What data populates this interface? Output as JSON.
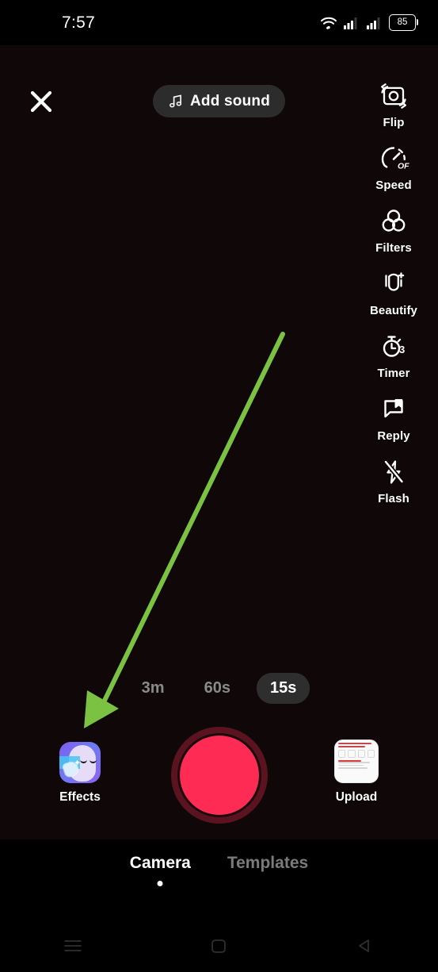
{
  "status_bar": {
    "time": "7:57",
    "battery_level": "85",
    "icons": [
      "wifi-icon",
      "signal-sim1-icon",
      "signal-sim2-icon",
      "battery-icon"
    ]
  },
  "header": {
    "close_label": "×",
    "close_icon": "close-icon",
    "add_sound_label": "Add sound",
    "add_sound_icon": "music-note-icon"
  },
  "tool_rail": [
    {
      "label": "Flip",
      "icon": "camera-flip-icon"
    },
    {
      "label": "Speed",
      "icon": "speedometer-icon",
      "badge": "OFF"
    },
    {
      "label": "Filters",
      "icon": "filters-circles-icon"
    },
    {
      "label": "Beautify",
      "icon": "beautify-face-icon"
    },
    {
      "label": "Timer",
      "icon": "stopwatch-icon",
      "badge": "3"
    },
    {
      "label": "Reply",
      "icon": "reply-bubble-icon"
    },
    {
      "label": "Flash",
      "icon": "flash-off-icon"
    }
  ],
  "durations": {
    "options": [
      {
        "label": "3m",
        "selected": false
      },
      {
        "label": "60s",
        "selected": false
      },
      {
        "label": "15s",
        "selected": true
      }
    ],
    "selected": "15s"
  },
  "controls": {
    "effects_label": "Effects",
    "effects_icon": "effects-thumbnail-icon",
    "record_icon": "record-button-icon",
    "upload_label": "Upload",
    "upload_icon": "upload-thumbnail-icon"
  },
  "mode_bar": {
    "modes": [
      {
        "label": "Camera",
        "active": true
      },
      {
        "label": "Templates",
        "active": false
      }
    ],
    "active": "Camera"
  },
  "nav_bar": {
    "items": [
      {
        "icon": "recents-menu-icon"
      },
      {
        "icon": "home-square-icon"
      },
      {
        "icon": "back-triangle-icon"
      }
    ]
  },
  "annotation": {
    "type": "arrow",
    "color": "#7cc242",
    "from": "357,421",
    "to": "112,915",
    "points_at": "Effects"
  },
  "colors": {
    "accent_record": "#fe2c55",
    "annotation_green": "#7cc242",
    "viewport_bg": "#100808",
    "pill_bg": "#2c2c2c"
  }
}
